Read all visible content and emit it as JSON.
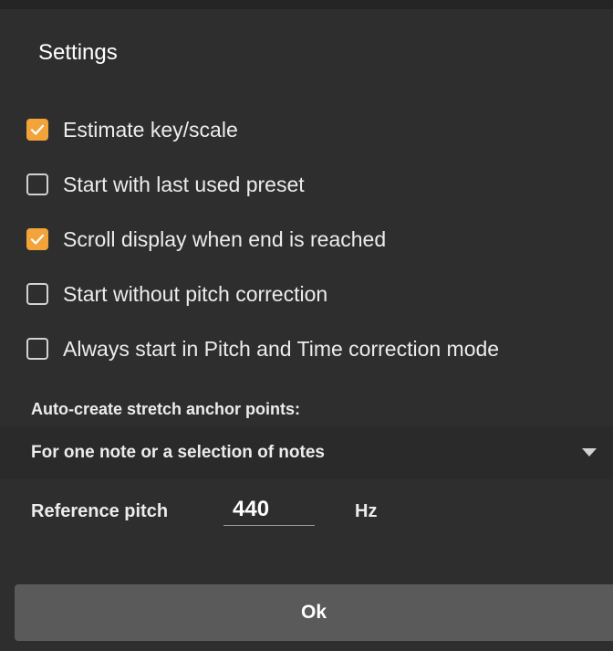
{
  "dialog": {
    "title": "Settings"
  },
  "checkboxes": [
    {
      "label": "Estimate key/scale",
      "checked": true
    },
    {
      "label": "Start with last used preset",
      "checked": false
    },
    {
      "label": "Scroll display when end is reached",
      "checked": true
    },
    {
      "label": "Start without pitch correction",
      "checked": false
    },
    {
      "label": "Always start in Pitch and Time correction mode",
      "checked": false
    }
  ],
  "stretch": {
    "label": "Auto-create stretch anchor points:",
    "selected": "For one note or a selection of notes"
  },
  "reference_pitch": {
    "label": "Reference pitch",
    "value": "440",
    "unit": "Hz"
  },
  "ok_label": "Ok",
  "colors": {
    "accent": "#f2a33a",
    "background": "#2e2e2e",
    "button": "#5a5a5a"
  }
}
